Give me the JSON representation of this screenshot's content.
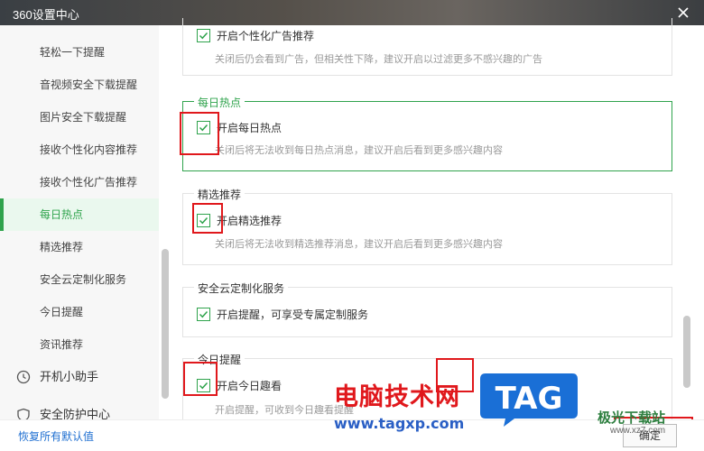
{
  "window": {
    "title": "360设置中心"
  },
  "sidebar": {
    "items": [
      {
        "label": "轻松一下提醒",
        "active": false
      },
      {
        "label": "音视频安全下载提醒",
        "active": false
      },
      {
        "label": "图片安全下载提醒",
        "active": false
      },
      {
        "label": "接收个性化内容推荐",
        "active": false
      },
      {
        "label": "接收个性化广告推荐",
        "active": false
      },
      {
        "label": "每日热点",
        "active": true
      },
      {
        "label": "精选推荐",
        "active": false
      },
      {
        "label": "安全云定制化服务",
        "active": false
      },
      {
        "label": "今日提醒",
        "active": false
      },
      {
        "label": "资讯推荐",
        "active": false
      }
    ],
    "groups": [
      {
        "label": "开机小助手",
        "icon": "clock-icon"
      },
      {
        "label": "安全防护中心",
        "icon": "shield-icon"
      }
    ]
  },
  "content": {
    "ads": {
      "checkbox": "开启个性化广告推荐",
      "checked": true,
      "desc": "关闭后仍会看到广告，但相关性下降，建议开启以过滤更多不感兴趣的广告"
    },
    "hot": {
      "title": "每日热点",
      "checkbox": "开启每日热点",
      "checked": true,
      "desc": "关闭后将无法收到每日热点消息，建议开启后看到更多感兴趣内容"
    },
    "picks": {
      "title": "精选推荐",
      "checkbox": "开启精选推荐",
      "checked": true,
      "desc": "关闭后将无法收到精选推荐消息，建议开启后看到更多感兴趣内容"
    },
    "cloud": {
      "title": "安全云定制化服务",
      "checkbox": "开启提醒，可享受专属定制服务",
      "checked": true
    },
    "today": {
      "title": "今日提醒",
      "checkbox": "开启今日趣看",
      "checked": true,
      "desc": "开启提醒，可收到今日趣看提醒"
    }
  },
  "footer": {
    "restore": "恢复所有默认值",
    "ok": "确定"
  },
  "watermark": {
    "site_name": "电脑技术网",
    "url": "www.tagxp.com",
    "logo": "TAG",
    "jg_name": "极光下载站",
    "jg_url": "www.xz7.com"
  },
  "colors": {
    "accent": "#2fa34c",
    "link": "#1f6fd1",
    "annotation": "#e0181c"
  }
}
